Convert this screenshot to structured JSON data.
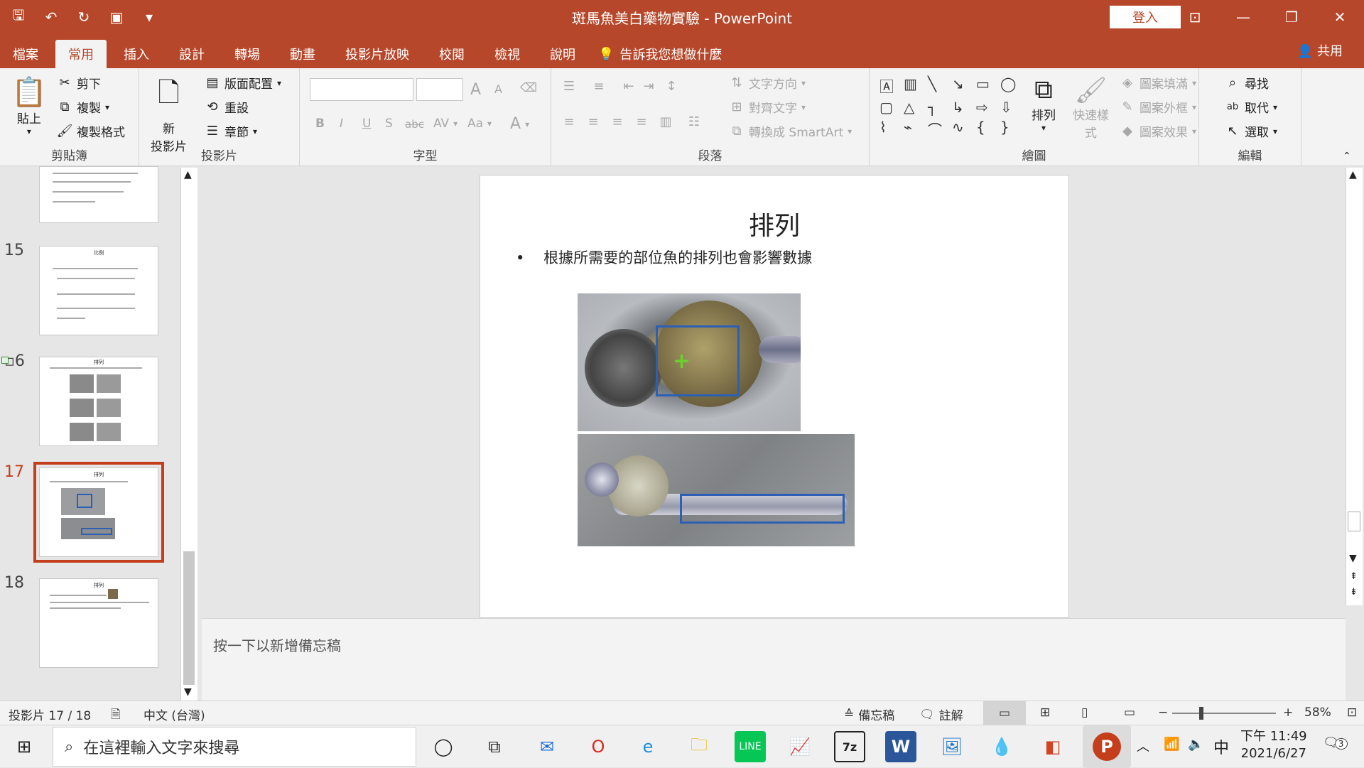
{
  "app": {
    "doc_title": "斑馬魚美白藥物實驗 - PowerPoint",
    "login_label": "登入",
    "share_label": "共用"
  },
  "tabs": [
    {
      "label": "檔案"
    },
    {
      "label": "常用"
    },
    {
      "label": "插入"
    },
    {
      "label": "設計"
    },
    {
      "label": "轉場"
    },
    {
      "label": "動畫"
    },
    {
      "label": "投影片放映"
    },
    {
      "label": "校閱"
    },
    {
      "label": "檢視"
    },
    {
      "label": "說明"
    }
  ],
  "tell_me": "告訴我您想做什麼",
  "ribbon": {
    "clipboard": {
      "paste": "貼上",
      "cut": "剪下",
      "copy": "複製",
      "format_painter": "複製格式",
      "label": "剪貼簿"
    },
    "slides": {
      "new_slide_1": "新",
      "new_slide_2": "投影片",
      "layout": "版面配置",
      "reset": "重設",
      "section": "章節",
      "label": "投影片"
    },
    "font": {
      "label": "字型",
      "bold": "B",
      "italic": "I",
      "underline": "U",
      "shadow": "S",
      "strike": "abc",
      "spacing": "AV",
      "case": "Aa",
      "color": "A",
      "grow": "A",
      "shrink": "A"
    },
    "paragraph": {
      "label": "段落",
      "text_direction": "文字方向",
      "align_text": "對齊文字",
      "smartart": "轉換成 SmartArt"
    },
    "drawing": {
      "label": "繪圖",
      "arrange": "排列",
      "quick_styles_1": "快速樣",
      "quick_styles_2": "式",
      "fill": "圖案填滿",
      "outline": "圖案外框",
      "effects": "圖案效果"
    },
    "editing": {
      "label": "編輯",
      "find": "尋找",
      "replace": "取代",
      "select": "選取"
    }
  },
  "thumbnails": [
    {
      "number": "15",
      "title": "比例"
    },
    {
      "number": "16",
      "title": "排列"
    },
    {
      "number": "17",
      "title": "排列"
    },
    {
      "number": "18",
      "title": "排列"
    }
  ],
  "slide": {
    "title": "排列",
    "bullet": "根據所需要的部位魚的排列也會影響數據"
  },
  "notes_placeholder": "按一下以新增備忘稿",
  "status": {
    "slide_info": "投影片 17 / 18",
    "language": "中文 (台灣)",
    "notes": "備忘稿",
    "comments": "註解",
    "zoom": "58%"
  },
  "taskbar": {
    "search_placeholder": "在這裡輸入文字來搜尋",
    "time": "下午 11:49",
    "date": "2021/6/27",
    "ime": "中",
    "notif_count": "3"
  }
}
